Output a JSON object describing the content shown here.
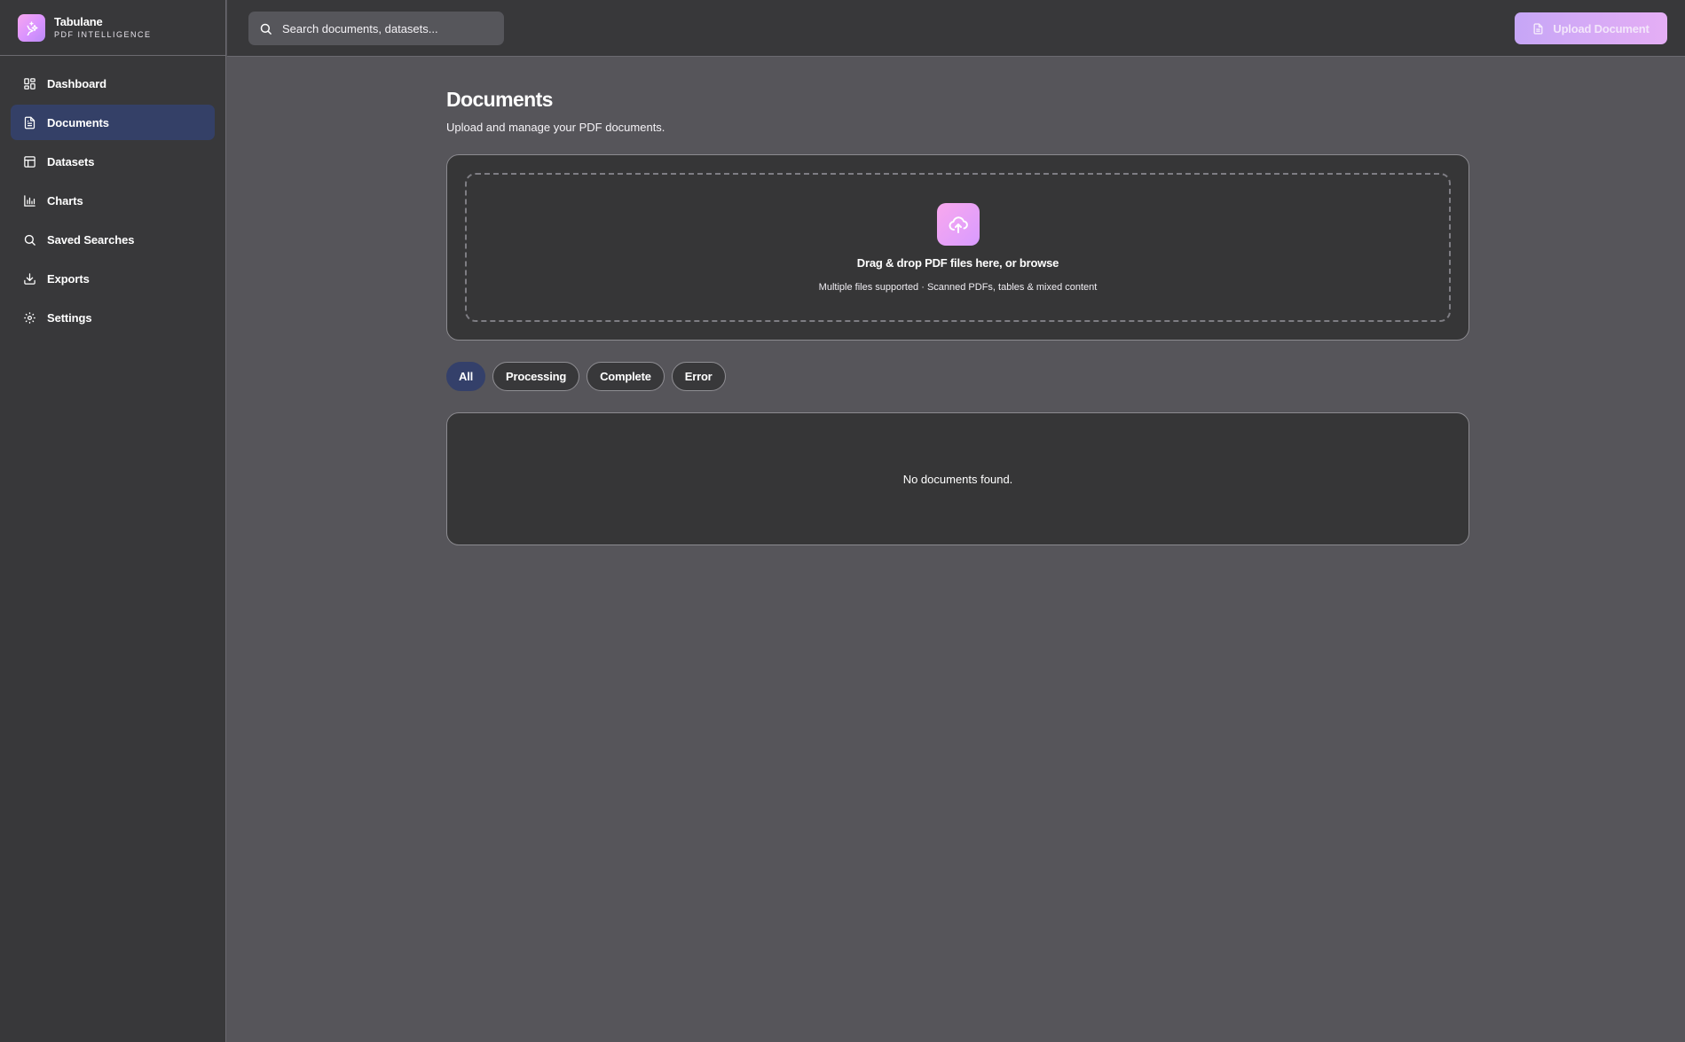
{
  "brand": {
    "name": "Tabulane",
    "subtitle": "PDF INTELLIGENCE",
    "logo_icon": "sparkle-icon"
  },
  "sidebar": {
    "items": [
      {
        "label": "Dashboard",
        "icon": "grid-icon",
        "active": false
      },
      {
        "label": "Documents",
        "icon": "file-text-icon",
        "active": true
      },
      {
        "label": "Datasets",
        "icon": "table-icon",
        "active": false
      },
      {
        "label": "Charts",
        "icon": "bar-chart-icon",
        "active": false
      },
      {
        "label": "Saved Searches",
        "icon": "search-icon",
        "active": false
      },
      {
        "label": "Exports",
        "icon": "download-icon",
        "active": false
      },
      {
        "label": "Settings",
        "icon": "gear-icon",
        "active": false
      }
    ]
  },
  "header": {
    "search_placeholder": "Search documents, datasets...",
    "upload_label": "Upload Document"
  },
  "main": {
    "title": "Documents",
    "subtitle": "Upload and manage your PDF documents.",
    "dropzone": {
      "title_prefix": "Drag & drop PDF files here, or ",
      "browse_label": "browse",
      "hint": "Multiple files supported · Scanned PDFs, tables & mixed content",
      "icon": "cloud-upload-icon"
    },
    "filters": [
      {
        "label": "All",
        "active": true
      },
      {
        "label": "Processing",
        "active": false
      },
      {
        "label": "Complete",
        "active": false
      },
      {
        "label": "Error",
        "active": false
      }
    ],
    "empty_message": "No documents found."
  },
  "colors": {
    "sidebar_bg": "#38383a",
    "main_bg": "#56555a",
    "active_nav": "#344067",
    "accent_gradient_start": "#c6a6f6",
    "accent_gradient_end": "#e5aef5"
  }
}
